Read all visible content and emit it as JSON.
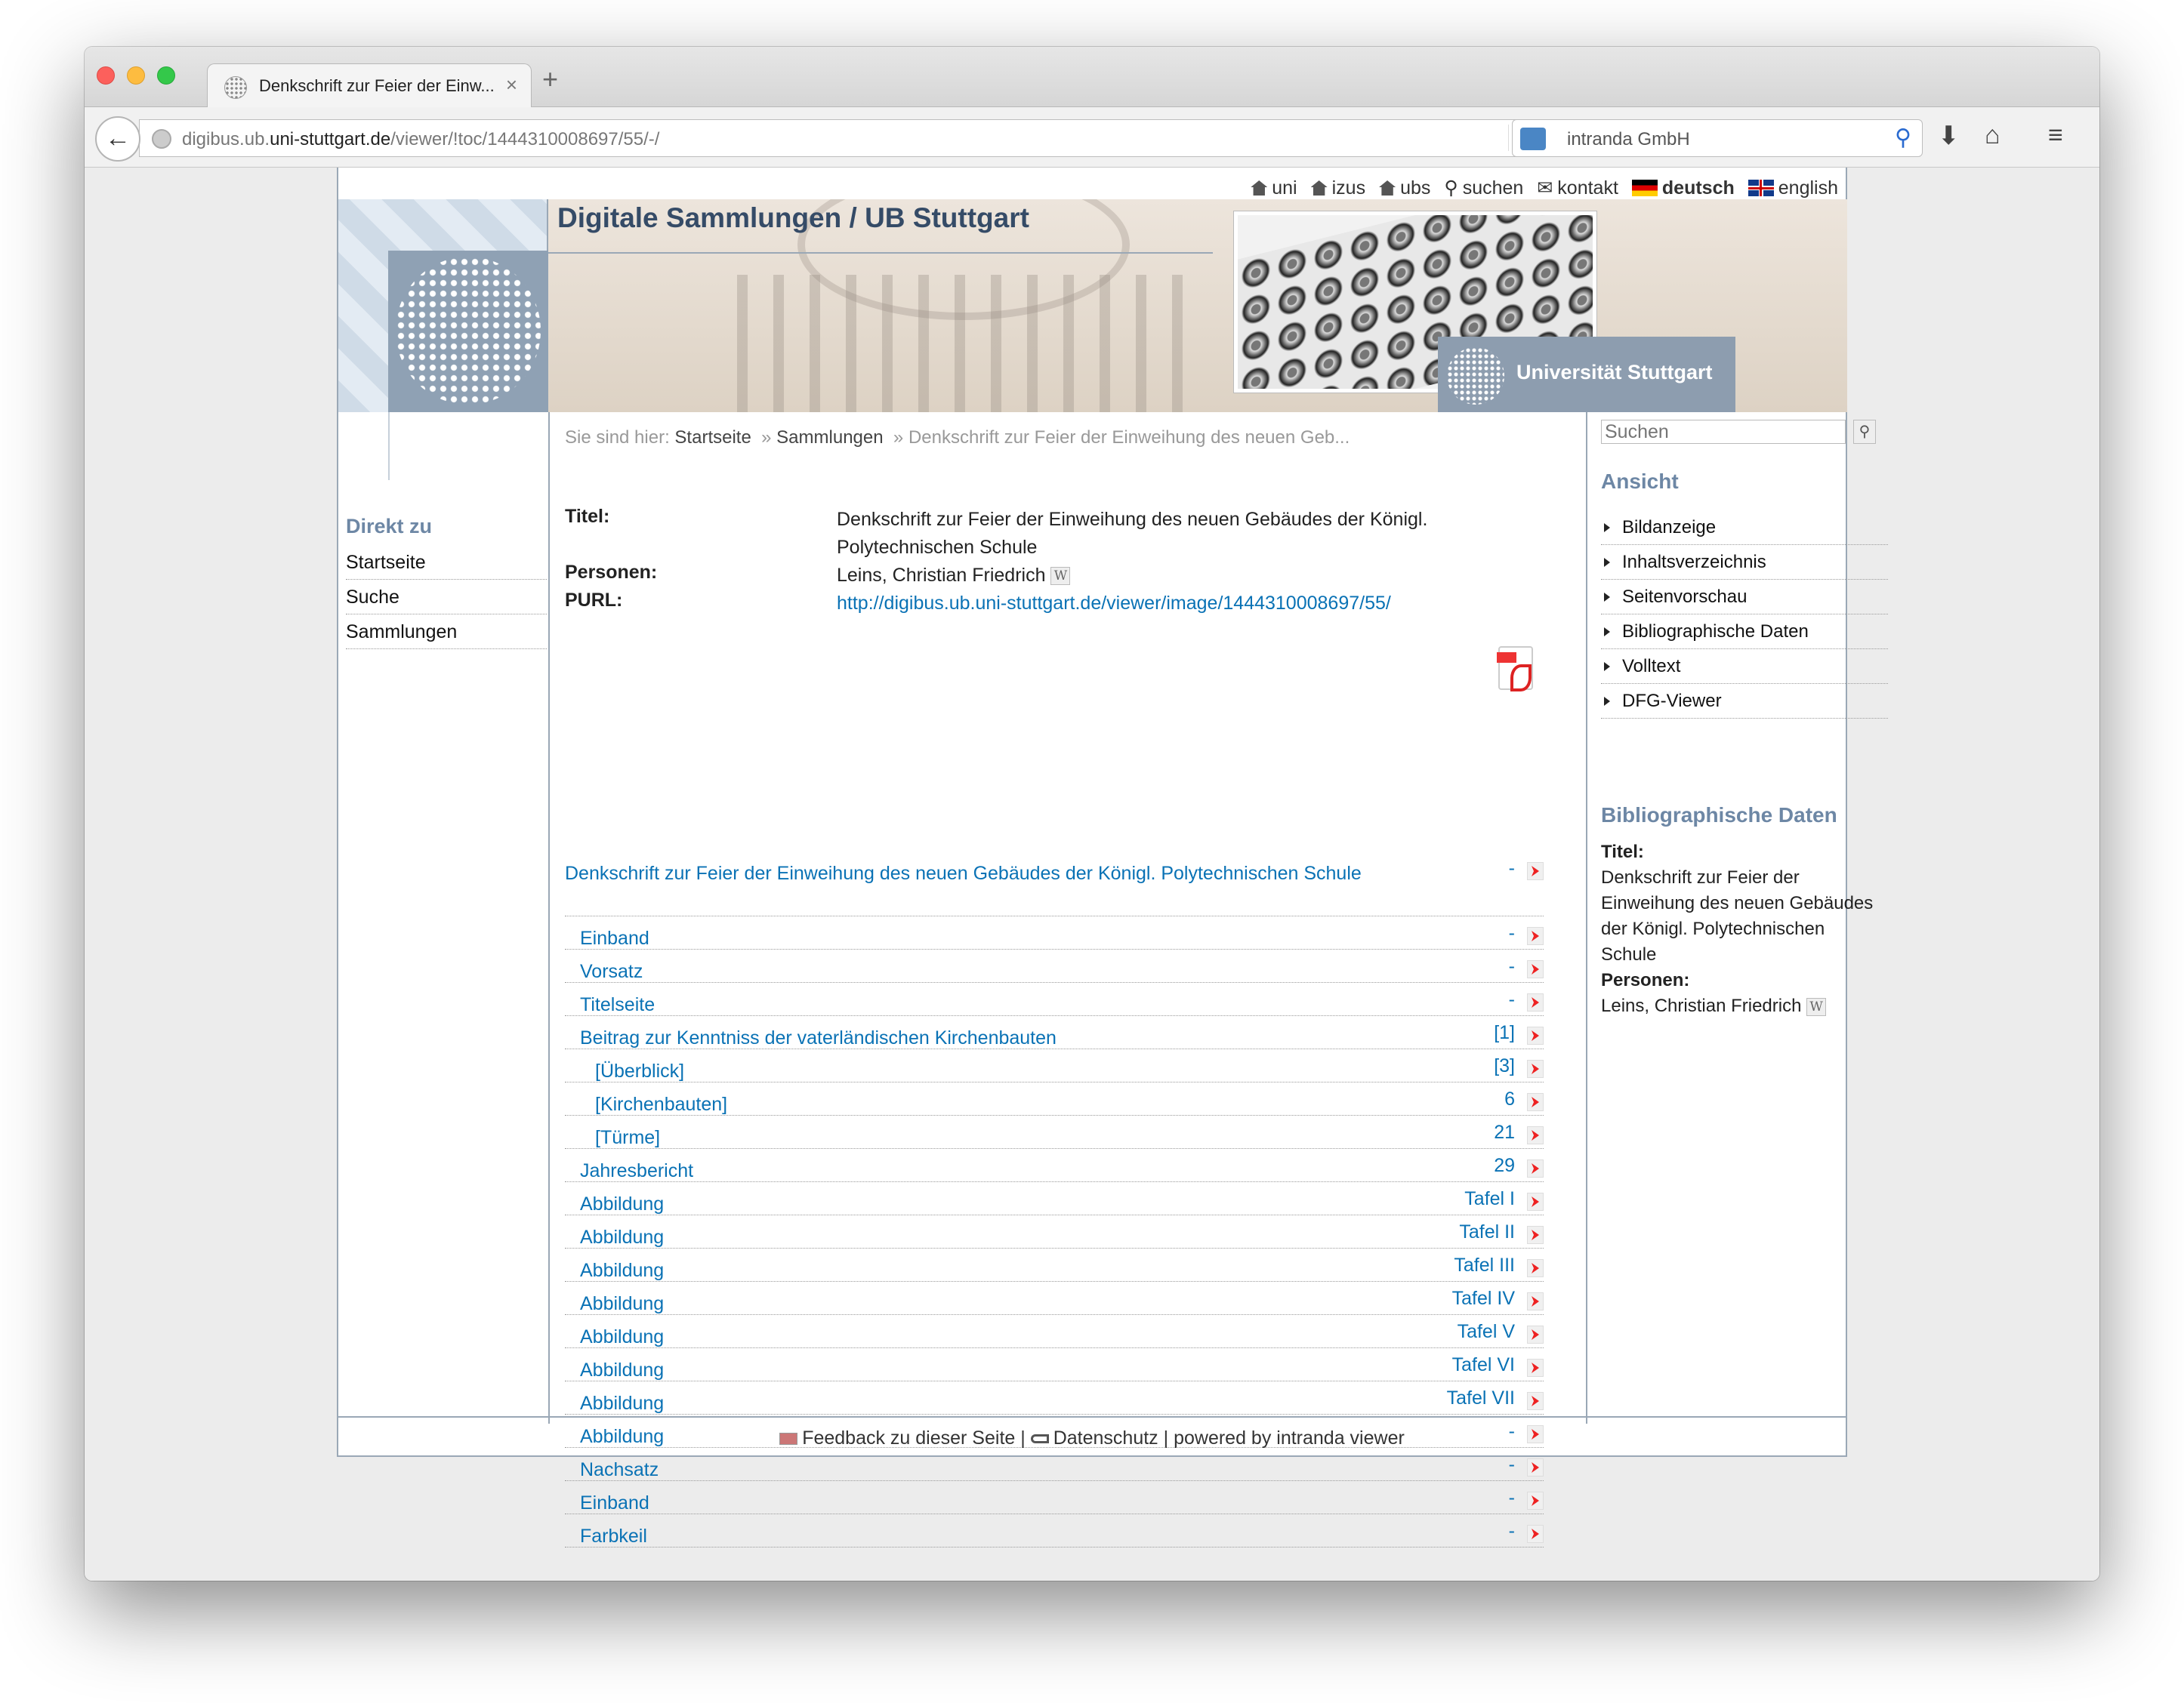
{
  "browser": {
    "tab_title": "Denkschrift zur Feier der Einw...",
    "url_host_pre": "digibus.ub.",
    "url_host_main": "uni-stuttgart.de",
    "url_path": "/viewer/!toc/1444310008697/55/-/",
    "search_placeholder": "intranda GmbH"
  },
  "topbar": {
    "links": [
      "uni",
      "izus",
      "ubs",
      "suchen",
      "kontakt"
    ],
    "lang_de": "deutsch",
    "lang_en": "english"
  },
  "header": {
    "site_title": "Digitale Sammlungen / UB Stuttgart",
    "uni_name": "Universität Stuttgart"
  },
  "leftnav": {
    "heading": "Direkt zu",
    "items": [
      "Startseite",
      "Suche",
      "Sammlungen"
    ]
  },
  "breadcrumb": {
    "prefix": "Sie sind hier:",
    "items": [
      "Startseite",
      "Sammlungen"
    ],
    "current": "Denkschrift zur Feier der Einweihung des neuen Geb..."
  },
  "metadata": {
    "title_label": "Titel:",
    "title_value": "Denkschrift zur Feier der Einweihung des neuen Gebäudes der Königl. Polytechnischen Schule",
    "persons_label": "Personen:",
    "persons_value": "Leins, Christian Friedrich",
    "purl_label": "PURL:",
    "purl_value": "http://digibus.ub.uni-stuttgart.de/viewer/image/1444310008697/55/"
  },
  "toc": [
    {
      "label": "Denkschrift zur Feier der Einweihung des neuen Gebäudes der Königl. Polytechnischen Schule",
      "page": "-",
      "level": 0
    },
    {
      "label": "Einband",
      "page": "-",
      "level": 1
    },
    {
      "label": "Vorsatz",
      "page": "-",
      "level": 1
    },
    {
      "label": "Titelseite",
      "page": "-",
      "level": 1
    },
    {
      "label": "Beitrag zur Kenntniss der vaterländischen Kirchenbauten",
      "page": "[1]",
      "level": 1
    },
    {
      "label": "[Überblick]",
      "page": "[3]",
      "level": 2
    },
    {
      "label": "[Kirchenbauten]",
      "page": "6",
      "level": 2
    },
    {
      "label": "[Türme]",
      "page": "21",
      "level": 2
    },
    {
      "label": "Jahresbericht",
      "page": "29",
      "level": 1
    },
    {
      "label": "Abbildung",
      "page": "Tafel I",
      "level": 1
    },
    {
      "label": "Abbildung",
      "page": "Tafel II",
      "level": 1
    },
    {
      "label": "Abbildung",
      "page": "Tafel III",
      "level": 1
    },
    {
      "label": "Abbildung",
      "page": "Tafel IV",
      "level": 1
    },
    {
      "label": "Abbildung",
      "page": "Tafel V",
      "level": 1
    },
    {
      "label": "Abbildung",
      "page": "Tafel VI",
      "level": 1
    },
    {
      "label": "Abbildung",
      "page": "Tafel VII",
      "level": 1
    },
    {
      "label": "Abbildung",
      "page": "-",
      "level": 1
    },
    {
      "label": "Nachsatz",
      "page": "-",
      "level": 1
    },
    {
      "label": "Einband",
      "page": "-",
      "level": 1
    },
    {
      "label": "Farbkeil",
      "page": "-",
      "level": 1
    }
  ],
  "sidebar": {
    "search_placeholder": "Suchen",
    "view_heading": "Ansicht",
    "view_items": [
      "Bildanzeige",
      "Inhaltsverzeichnis",
      "Seitenvorschau",
      "Bibliographische Daten",
      "Volltext",
      "DFG-Viewer"
    ],
    "bib_heading": "Bibliographische Daten",
    "bib_title_label": "Titel:",
    "bib_title_value": "Denkschrift zur Feier der Einweihung des neuen Gebäudes der Königl. Polytechnischen Schule",
    "bib_persons_label": "Personen:",
    "bib_persons_value": "Leins, Christian Friedrich"
  },
  "footer": {
    "feedback": "Feedback zu dieser Seite",
    "privacy": "Datenschutz",
    "powered": "powered by intranda viewer",
    "sep": "|"
  },
  "colors": {
    "link": "#0a72b5",
    "heading": "#6d87a5",
    "site_title": "#354b67"
  }
}
